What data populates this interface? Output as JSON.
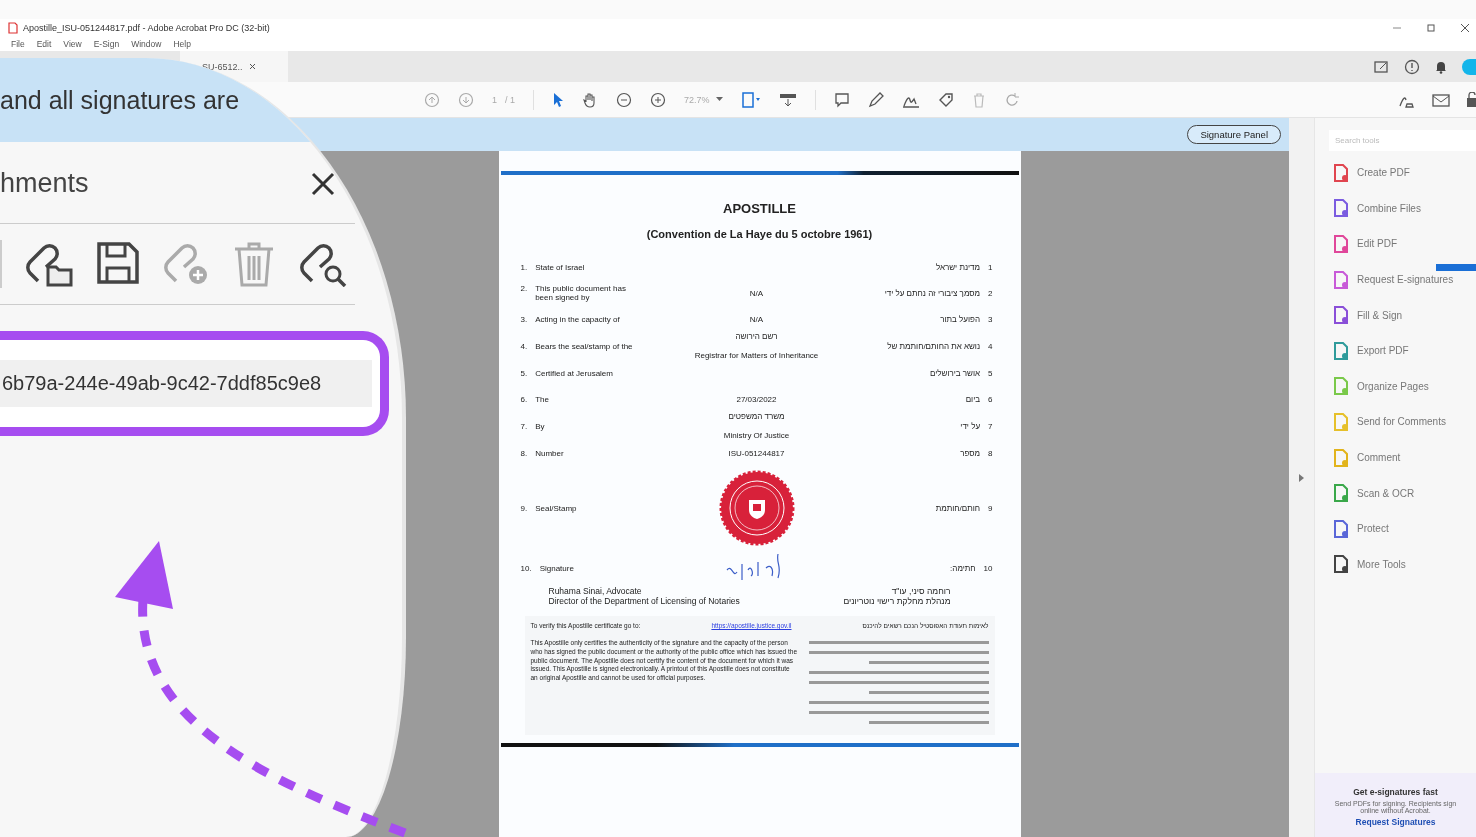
{
  "window": {
    "title": "Apostille_ISU-051244817.pdf - Adobe Acrobat Pro DC (32-bit)"
  },
  "menu": [
    "File",
    "Edit",
    "View",
    "E-Sign",
    "Window",
    "Help"
  ],
  "tabs": [
    {
      "label": "SU-6512..",
      "selected": true
    }
  ],
  "toolbar": {
    "page_current": "1",
    "page_total": "/ 1",
    "zoom": "72.7%"
  },
  "banner": {
    "button": "Signature Panel"
  },
  "document": {
    "title": "APOSTILLE",
    "subtitle": "(Convention de La Haye du 5 octobre 1961)",
    "fields": [
      {
        "num": "1.",
        "label": "State of Israel",
        "label_he": "מדינת ישראל",
        "num_he": "1"
      },
      {
        "num": "2.",
        "label": "This public document has been signed by",
        "value": "N/A",
        "label_he": "מסמך ציבורי זה נחתם על ידי",
        "num_he": "2"
      },
      {
        "num": "3.",
        "label": "Acting in the capacity of",
        "value": "N/A",
        "label_he": "הפועל בתור",
        "num_he": "3"
      },
      {
        "num": "4.",
        "label": "Bears the seal/stamp of the",
        "value": "Registrar for Matters of Inheritance",
        "value_he": "רשם הירושה",
        "label_he": "נושא את החותם/חותמת של",
        "num_he": "4"
      },
      {
        "num": "5.",
        "label": "Certified at Jerusalem",
        "label_he": "אושר בירושלים",
        "num_he": "5"
      },
      {
        "num": "6.",
        "label": "The",
        "value": "27/03/2022",
        "label_he": "ביום",
        "num_he": "6"
      },
      {
        "num": "7.",
        "label": "By",
        "value": "Ministry Of Justice",
        "value_he": "משרד המשפטים",
        "label_he": "על ידי",
        "num_he": "7"
      },
      {
        "num": "8.",
        "label": "Number",
        "value": "ISU-051244817",
        "label_he": "מספר",
        "num_he": "8"
      },
      {
        "num": "9.",
        "label": "Seal/Stamp",
        "label_he": "חותם/חותמת",
        "num_he": "9"
      },
      {
        "num": "10.",
        "label": "Signature",
        "label_he": "חתימה:",
        "num_he": "10"
      }
    ],
    "signer": [
      {
        "en": "Ruhama Sinai, Advocate",
        "he": "רוחמה סיני, עו\"ד"
      },
      {
        "en": "Director of the Department of Licensing of Notaries",
        "he": "מנהלת מחלקת רישוי נוטריונים"
      }
    ],
    "verify": {
      "text": "To verify this Apostille certificate go to:",
      "link": "https://apostille.justice.gov.il",
      "text_he": "לאימות תעודת האפוסטיל הנכם רשאים להיכנס"
    },
    "notice": "This Apostille only certifies the authenticity of the signature and the capacity of the person who has signed the public document or the authority of the public office which has issued the public document. The Apostille does not certify the content of the document for which it was issued. This Apostille is signed electronically. A printout of this Apostille does not constitute an original Apostille and cannot be used for official purposes."
  },
  "tools_panel": {
    "search_placeholder": "Search tools",
    "items": [
      {
        "label": "Create PDF",
        "color": "#e0454f",
        "badge": false
      },
      {
        "label": "Combine Files",
        "color": "#7b5ce0",
        "badge": false
      },
      {
        "label": "Edit PDF",
        "color": "#e0479a",
        "badge": false
      },
      {
        "label": "Request E-signatures",
        "color": "#c85ad8",
        "badge": true
      },
      {
        "label": "Fill & Sign",
        "color": "#8a4fd8",
        "badge": false
      },
      {
        "label": "Export PDF",
        "color": "#2f9b9b",
        "badge": false
      },
      {
        "label": "Organize Pages",
        "color": "#7ac94a",
        "badge": false
      },
      {
        "label": "Send for Comments",
        "color": "#e6c02a",
        "badge": false
      },
      {
        "label": "Comment",
        "color": "#e2b41c",
        "badge": false
      },
      {
        "label": "Scan & OCR",
        "color": "#3aa84a",
        "badge": false
      },
      {
        "label": "Protect",
        "color": "#5a67d8",
        "badge": false
      },
      {
        "label": "More Tools",
        "color": "#444444",
        "badge": false
      }
    ],
    "promo": {
      "title": "Get e-signatures fast",
      "text": "Send PDFs for signing. Recipients sign online without Acrobat.",
      "link": "Request Signatures"
    }
  },
  "magnifier": {
    "banner_text": "and all signatures are",
    "panel_title": "hments",
    "attachment_name": "6b79a-244e-49ab-9c42-7ddf85c9e8"
  }
}
